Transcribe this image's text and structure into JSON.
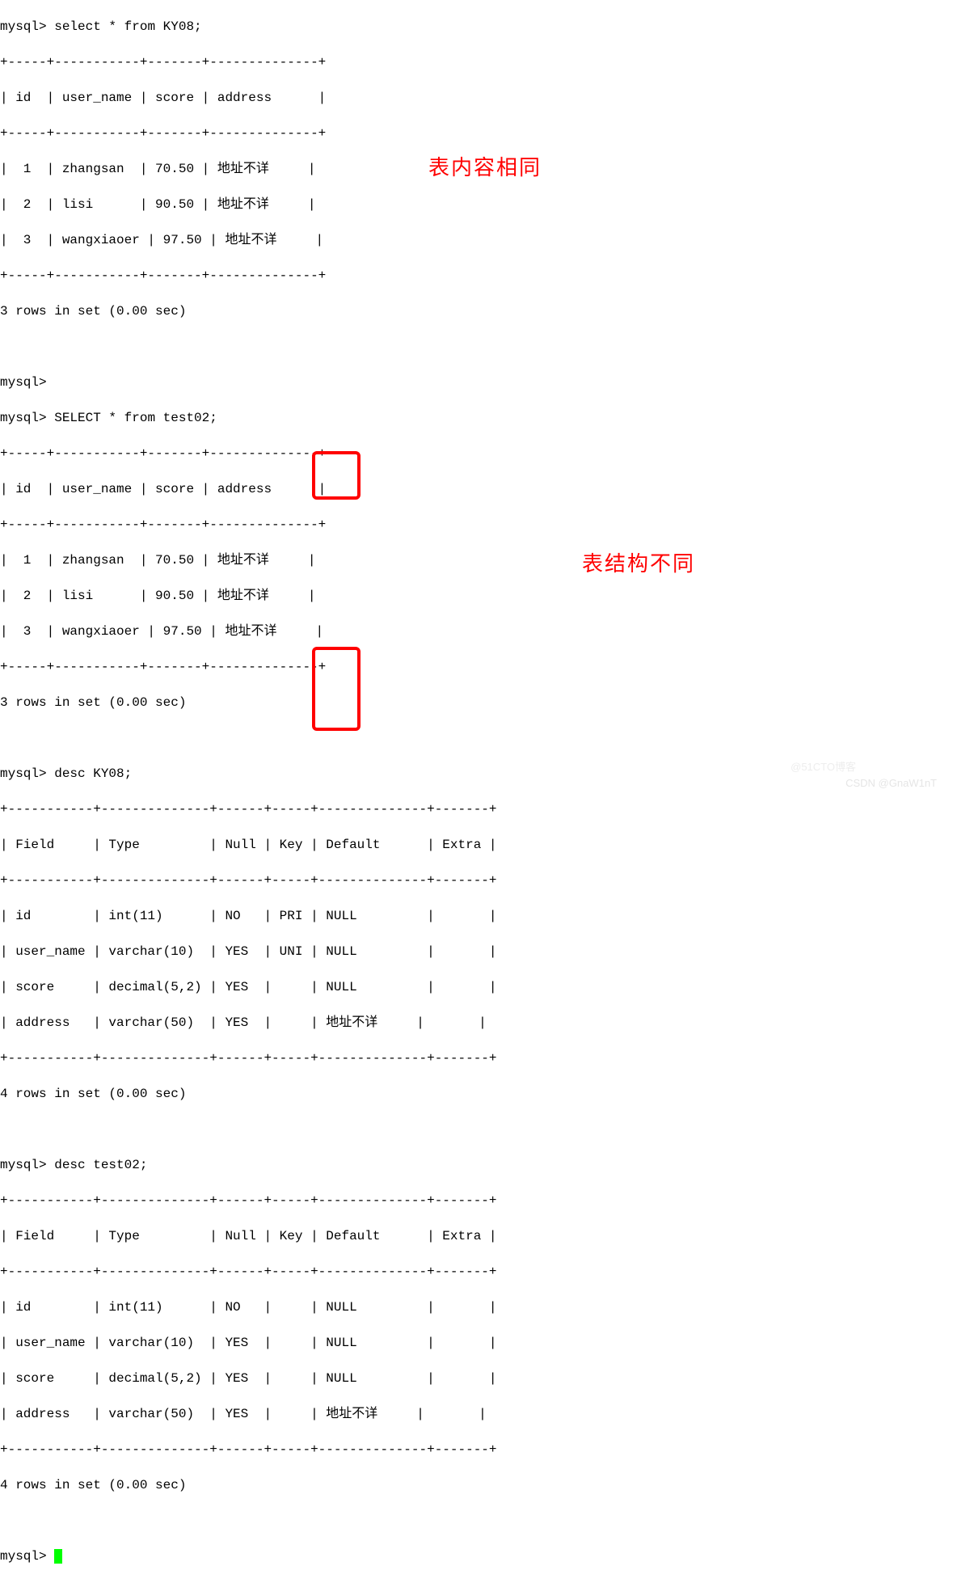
{
  "cmd1": {
    "prompt": "mysql>",
    "sql": "select * from KY08;"
  },
  "table1": {
    "border_top": "+-----+-----------+-------+--------------+",
    "header": "| id  | user_name | score | address      |",
    "border_mid": "+-----+-----------+-------+--------------+",
    "row1": "|  1  | zhangsan  | 70.50 | 地址不详     |",
    "row2": "|  2  | lisi      | 90.50 | 地址不详     |",
    "row3": "|  3  | wangxiaoer | 97.50 | 地址不详     |",
    "border_bot": "+-----+-----------+-------+--------------+",
    "status": "3 rows in set (0.00 sec)"
  },
  "cmd2a": {
    "prompt": "mysql>",
    "sql": ""
  },
  "cmd2": {
    "prompt": "mysql>",
    "sql": "SELECT * from test02;"
  },
  "table2": {
    "border_top": "+-----+-----------+-------+--------------+",
    "header": "| id  | user_name | score | address      |",
    "border_mid": "+-----+-----------+-------+--------------+",
    "row1": "|  1  | zhangsan  | 70.50 | 地址不详     |",
    "row2": "|  2  | lisi      | 90.50 | 地址不详     |",
    "row3": "|  3  | wangxiaoer | 97.50 | 地址不详     |",
    "border_bot": "+-----+-----------+-------+--------------+",
    "status": "3 rows in set (0.00 sec)"
  },
  "cmd3": {
    "prompt": "mysql>",
    "sql": "desc KY08;"
  },
  "desc1": {
    "border_top": "+-----------+--------------+------+-----+--------------+-------+",
    "header": "| Field     | Type         | Null | Key | Default      | Extra |",
    "border_mid": "+-----------+--------------+------+-----+--------------+-------+",
    "row1": "| id        | int(11)      | NO   | PRI | NULL         |       |",
    "row2": "| user_name | varchar(10)  | YES  | UNI | NULL         |       |",
    "row3": "| score     | decimal(5,2) | YES  |     | NULL         |       |",
    "row4": "| address   | varchar(50)  | YES  |     | 地址不详     |       |",
    "border_bot": "+-----------+--------------+------+-----+--------------+-------+",
    "status": "4 rows in set (0.00 sec)"
  },
  "cmd4": {
    "prompt": "mysql>",
    "sql": "desc test02;"
  },
  "desc2": {
    "border_top": "+-----------+--------------+------+-----+--------------+-------+",
    "header": "| Field     | Type         | Null | Key | Default      | Extra |",
    "border_mid": "+-----------+--------------+------+-----+--------------+-------+",
    "row1": "| id        | int(11)      | NO   |     | NULL         |       |",
    "row2": "| user_name | varchar(10)  | YES  |     | NULL         |       |",
    "row3": "| score     | decimal(5,2) | YES  |     | NULL         |       |",
    "row4": "| address   | varchar(50)  | YES  |     | 地址不详     |       |",
    "border_bot": "+-----------+--------------+------+-----+--------------+-------+",
    "status": "4 rows in set (0.00 sec)"
  },
  "final_prompt": "mysql> ",
  "annotations": {
    "same_content": "表内容相同",
    "diff_structure": "表结构不同"
  },
  "watermark1": "@51CTO博客",
  "watermark2": "CSDN @GnaW1nT"
}
